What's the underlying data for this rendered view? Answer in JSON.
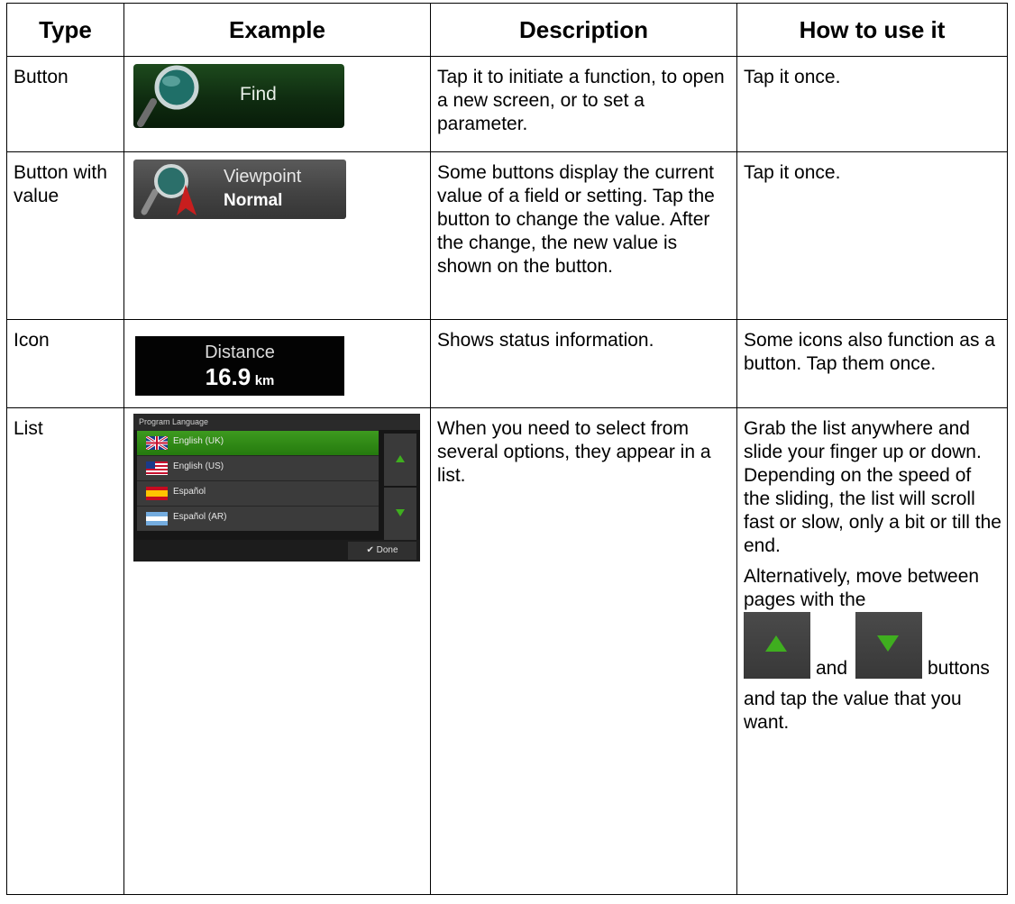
{
  "headers": [
    "Type",
    "Example",
    "Description",
    "How to use it"
  ],
  "rows": [
    {
      "type": "Button",
      "example": {
        "label": "Find"
      },
      "description": "Tap it to initiate a function, to open a new screen, or to set a parameter.",
      "how": "Tap it once."
    },
    {
      "type": "Button with value",
      "example": {
        "title": "Viewpoint",
        "value": "Normal"
      },
      "description": "Some buttons display the current value of a field or setting. Tap the button to change the value. After the change, the new value is shown on the button.",
      "how": "Tap it once."
    },
    {
      "type": "Icon",
      "example": {
        "title": "Distance",
        "value": "16.9",
        "unit": "km"
      },
      "description": "Shows status information.",
      "how": "Some icons also function as a button. Tap them once."
    },
    {
      "type": "List",
      "example": {
        "header": "Program Language",
        "items": [
          "English (UK)",
          "English (US)",
          "Español",
          "Español (AR)"
        ],
        "selected": "English (UK)",
        "done_label": "Done"
      },
      "description": "When you need to select from several options, they appear in a list.",
      "how": "Grab the list anywhere and slide your finger up or down. Depending on the speed of the sliding, the list will scroll fast or slow, only a bit or till the end.",
      "how_alt_intro": "Alternatively, move between pages with the",
      "how_and": "and",
      "how_buttons": "buttons",
      "how_end": "and tap the value that you want."
    }
  ],
  "colors": {
    "accent_green": "#3fae1f",
    "button_green_dark": "#0f2c10"
  }
}
